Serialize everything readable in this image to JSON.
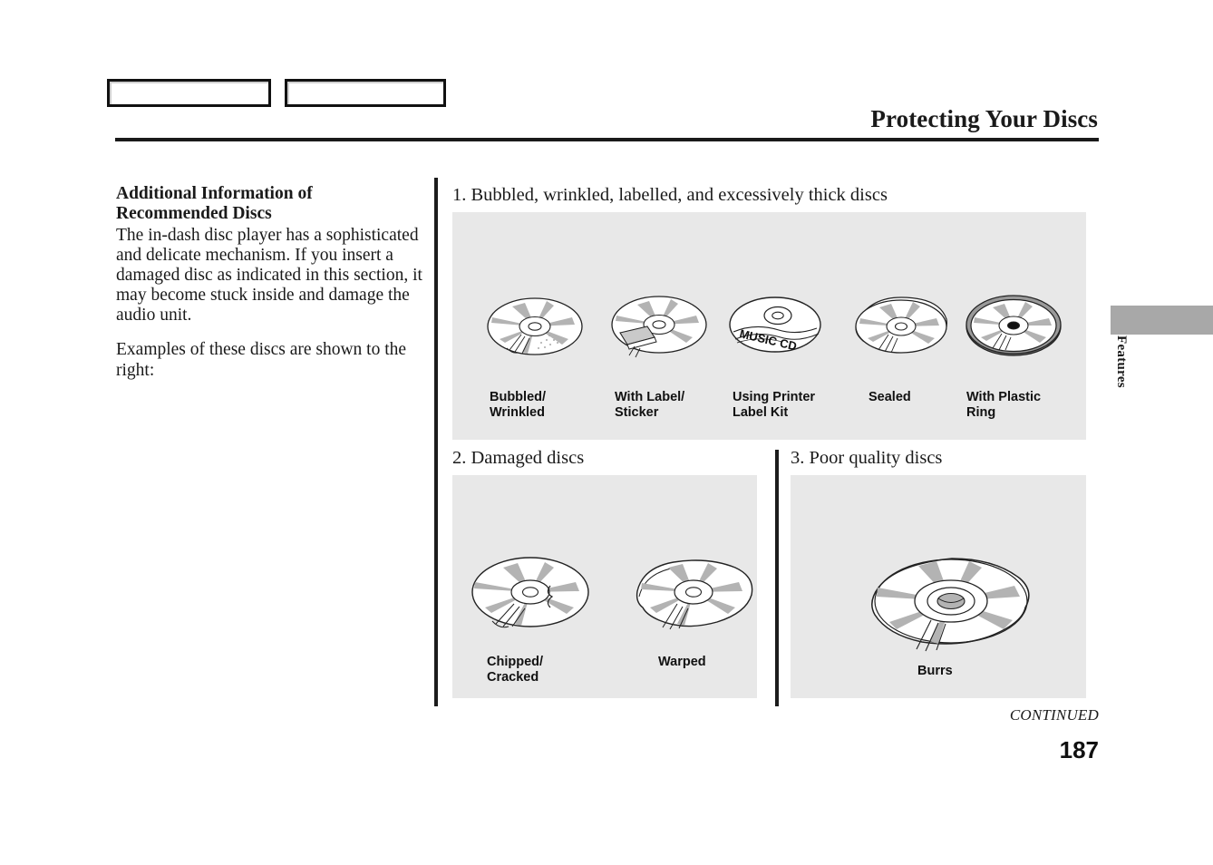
{
  "page": {
    "title": "Protecting Your Discs",
    "number": "187",
    "continued_label": "CONTINUED",
    "side_tab_label": "Features",
    "panel_bg": "#e8e8e8",
    "tab_bar_color": "#a8a8a8"
  },
  "top_boxes": [
    {
      "name": "top-box-left",
      "text": ""
    },
    {
      "name": "top-box-right",
      "text": ""
    }
  ],
  "left_column": {
    "heading": "Additional Information of Recommended Discs",
    "paragraph_1": "The in-dash disc player has a sophisticated and delicate mechanism. If you insert a damaged disc as indicated in this section, it may become stuck inside and damage the audio unit.",
    "paragraph_2": "Examples of these discs are shown to the right:"
  },
  "sections": [
    {
      "heading": "1. Bubbled, wrinkled, labelled, and excessively thick discs",
      "items": [
        {
          "label": "Bubbled/\nWrinkled",
          "icon": "disc-bubbled-icon"
        },
        {
          "label": "With Label/\nSticker",
          "icon": "disc-with-label-icon"
        },
        {
          "label": "Using Printer\nLabel Kit",
          "icon": "disc-printer-label-icon",
          "disc_text": "MUSIC CD"
        },
        {
          "label": "Sealed",
          "icon": "disc-sealed-icon"
        },
        {
          "label": "With Plastic\nRing",
          "icon": "disc-plastic-ring-icon"
        }
      ]
    },
    {
      "heading": "2. Damaged discs",
      "items": [
        {
          "label": "Chipped/\nCracked",
          "icon": "disc-chipped-icon"
        },
        {
          "label": "Warped",
          "icon": "disc-warped-icon"
        }
      ]
    },
    {
      "heading": "3. Poor quality discs",
      "items": [
        {
          "label": "Burrs",
          "icon": "disc-burrs-icon"
        }
      ]
    }
  ]
}
